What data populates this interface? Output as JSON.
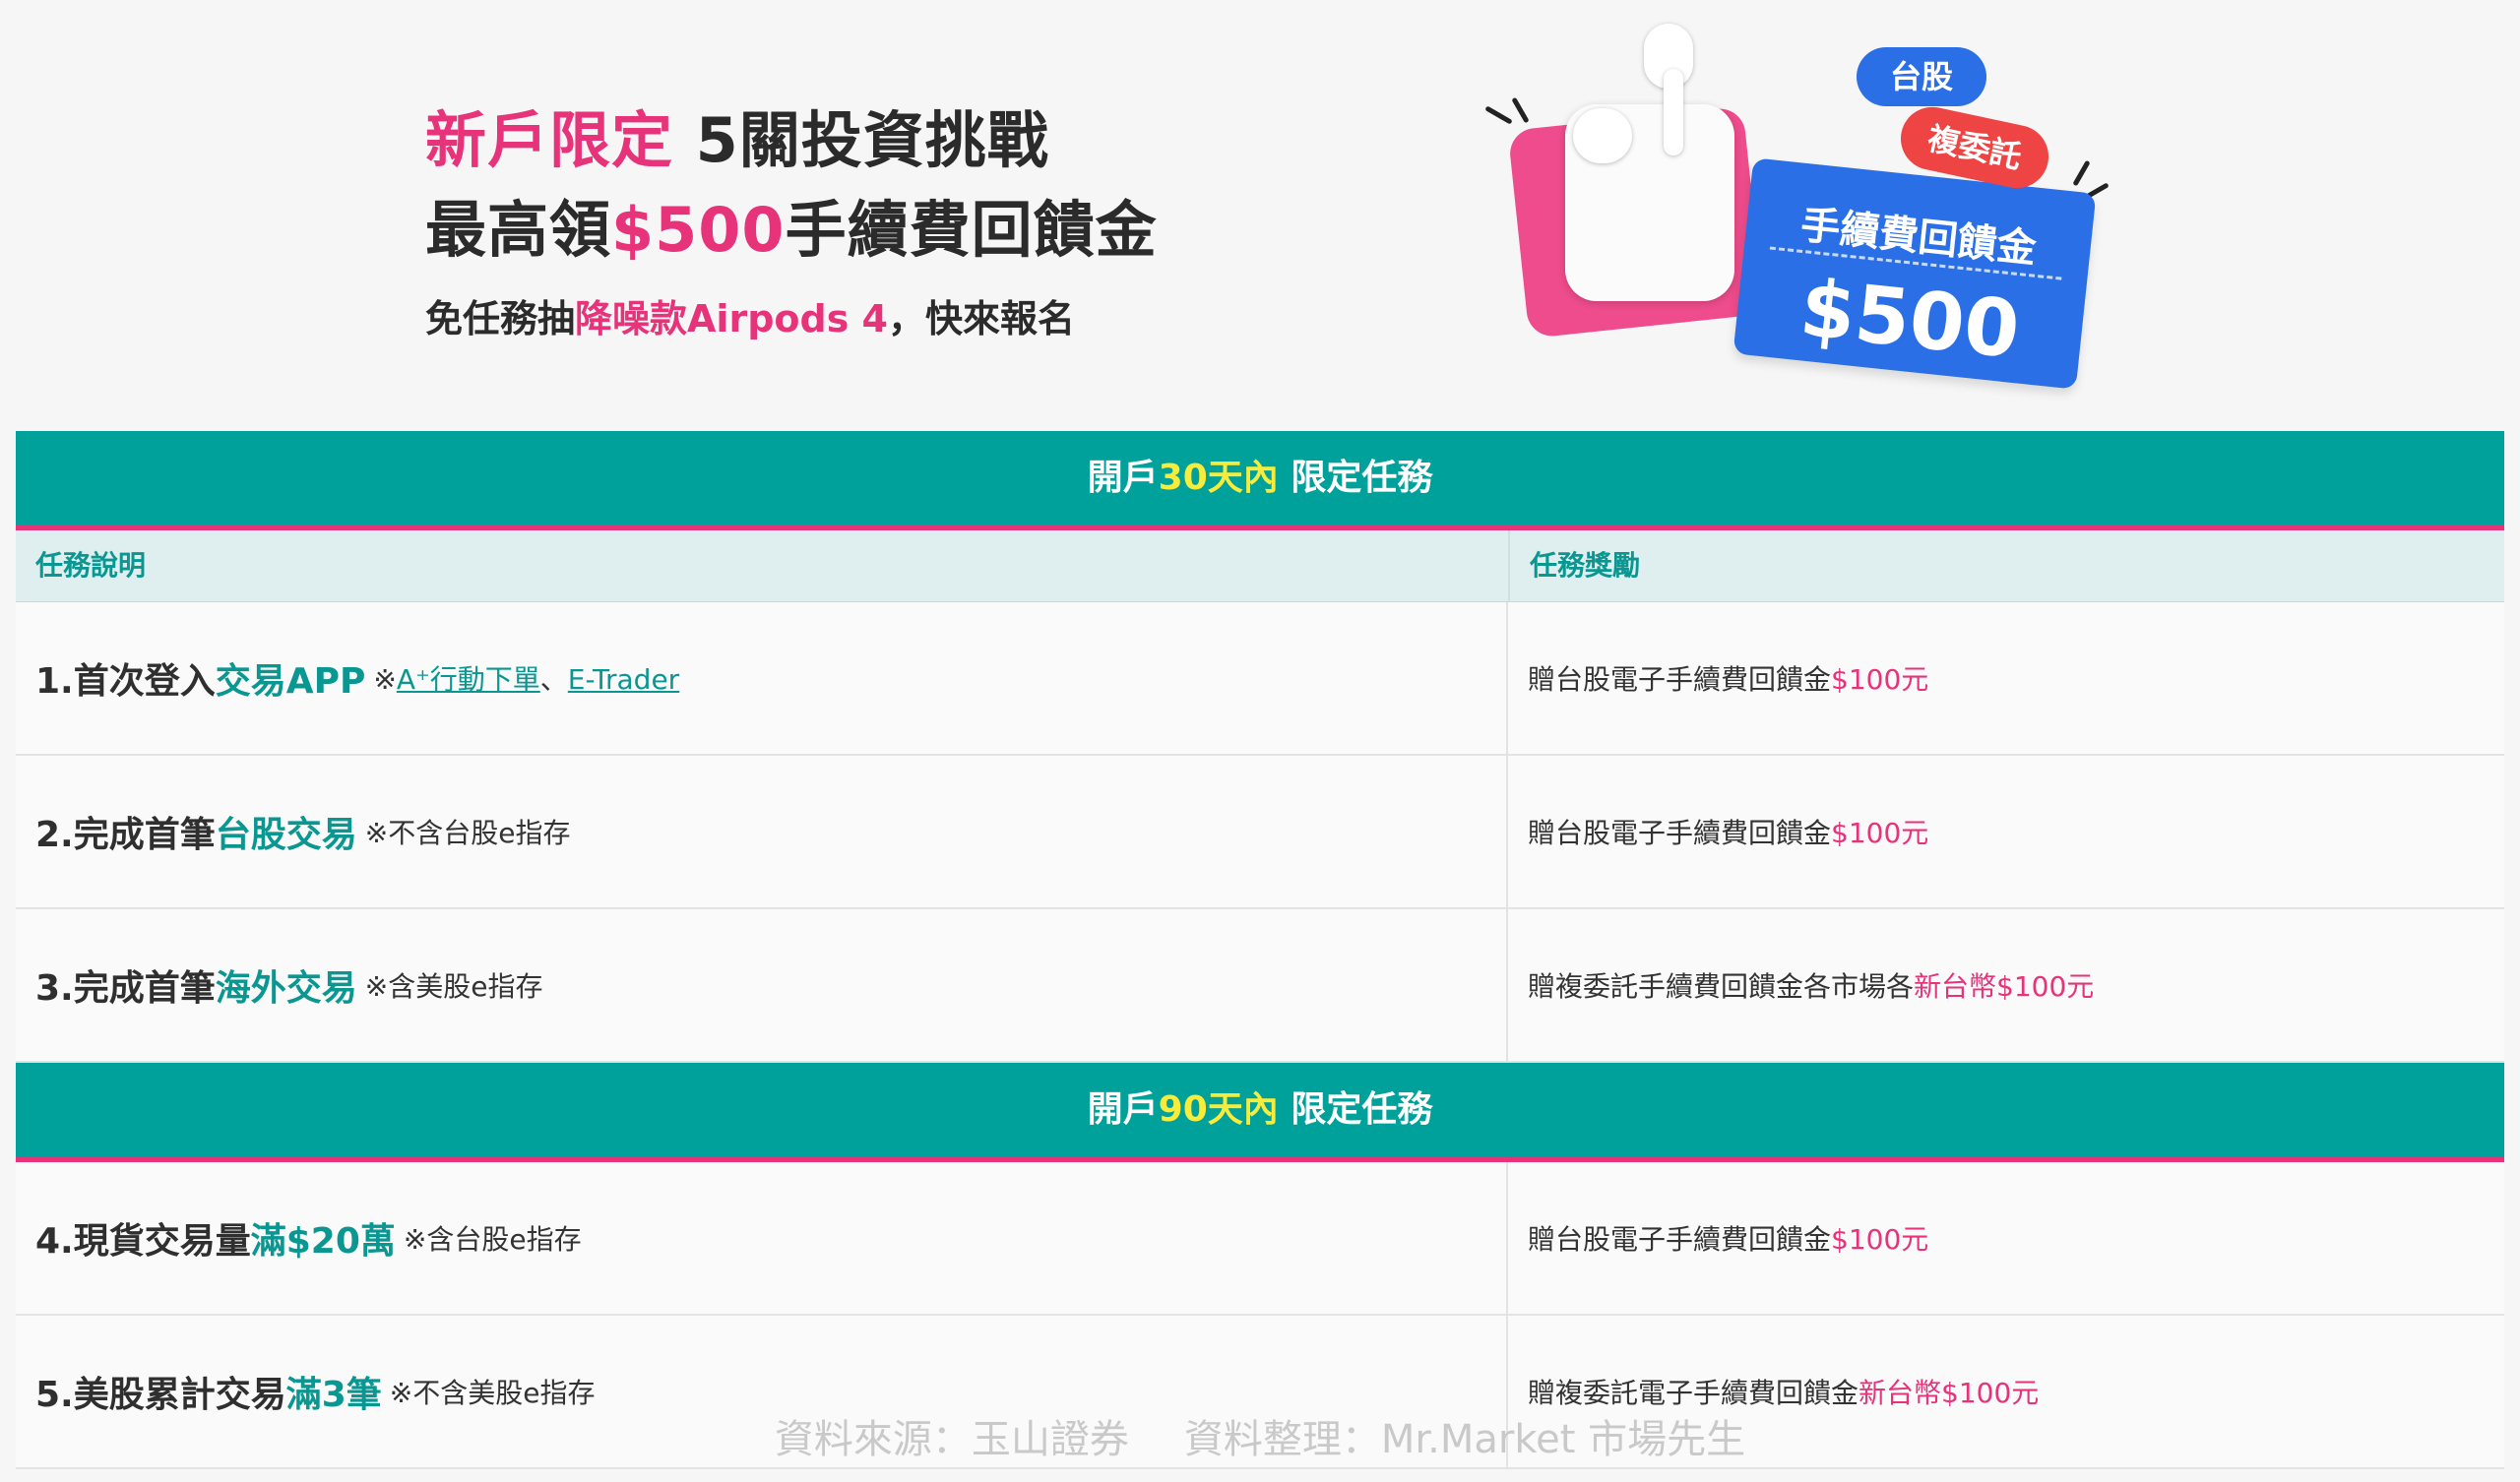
{
  "hero": {
    "line1_highlight": "新戶限定",
    "line1_text": " 5關投資挑戰",
    "line2_prefix": "最高領",
    "line2_amount": "$500",
    "line2_suffix": "手續費回饋金",
    "line3_prefix": "免任務抽",
    "line3_highlight": "降噪款Airpods 4",
    "line3_suffix": "，快來報名"
  },
  "artwork": {
    "badge_tw": "台股",
    "badge_multi": "複委託",
    "ticket_title": "手續費回饋金",
    "ticket_amount": "$500"
  },
  "sections": [
    {
      "prefix": "開戶",
      "highlight": "30天內",
      "suffix": " 限定任務"
    },
    {
      "prefix": "開戶",
      "highlight": "90天內",
      "suffix": " 限定任務"
    }
  ],
  "columns": {
    "task": "任務說明",
    "reward": "任務獎勵"
  },
  "tasks": [
    {
      "prefix": "1.首次登入",
      "highlight": "交易APP",
      "note_mark": "※",
      "link1": "A⁺行動下單",
      "sep": "、",
      "link2": "E-Trader",
      "reward_text": "贈台股電子手續費回饋金",
      "reward_amount": "$100元"
    },
    {
      "prefix": "2.完成首筆",
      "highlight": "台股交易",
      "note": "※不含台股e指存",
      "reward_text": "贈台股電子手續費回饋金",
      "reward_amount": "$100元"
    },
    {
      "prefix": "3.完成首筆",
      "highlight": "海外交易",
      "note": "※含美股e指存",
      "reward_text": "贈複委託手續費回饋金各市場各",
      "reward_amount": "新台幣$100元"
    },
    {
      "prefix": "4.現貨交易量",
      "highlight": "滿$20萬",
      "note": "※含台股e指存",
      "reward_text": "贈台股電子手續費回饋金",
      "reward_amount": "$100元"
    },
    {
      "prefix": "5.美股累計交易",
      "highlight": "滿3筆",
      "note": "※不含美股e指存",
      "reward_text": "贈複委託電子手續費回饋金",
      "reward_amount": "新台幣$100元"
    }
  ],
  "footer": {
    "source": "資料來源：玉山證券",
    "compiled": "資料整理：Mr.Market 市場先生"
  },
  "colors": {
    "teal": "#00a19b",
    "pink": "#e6337a",
    "yellow": "#f7ec3b",
    "blue": "#2b6fe6",
    "red": "#ef4444"
  }
}
